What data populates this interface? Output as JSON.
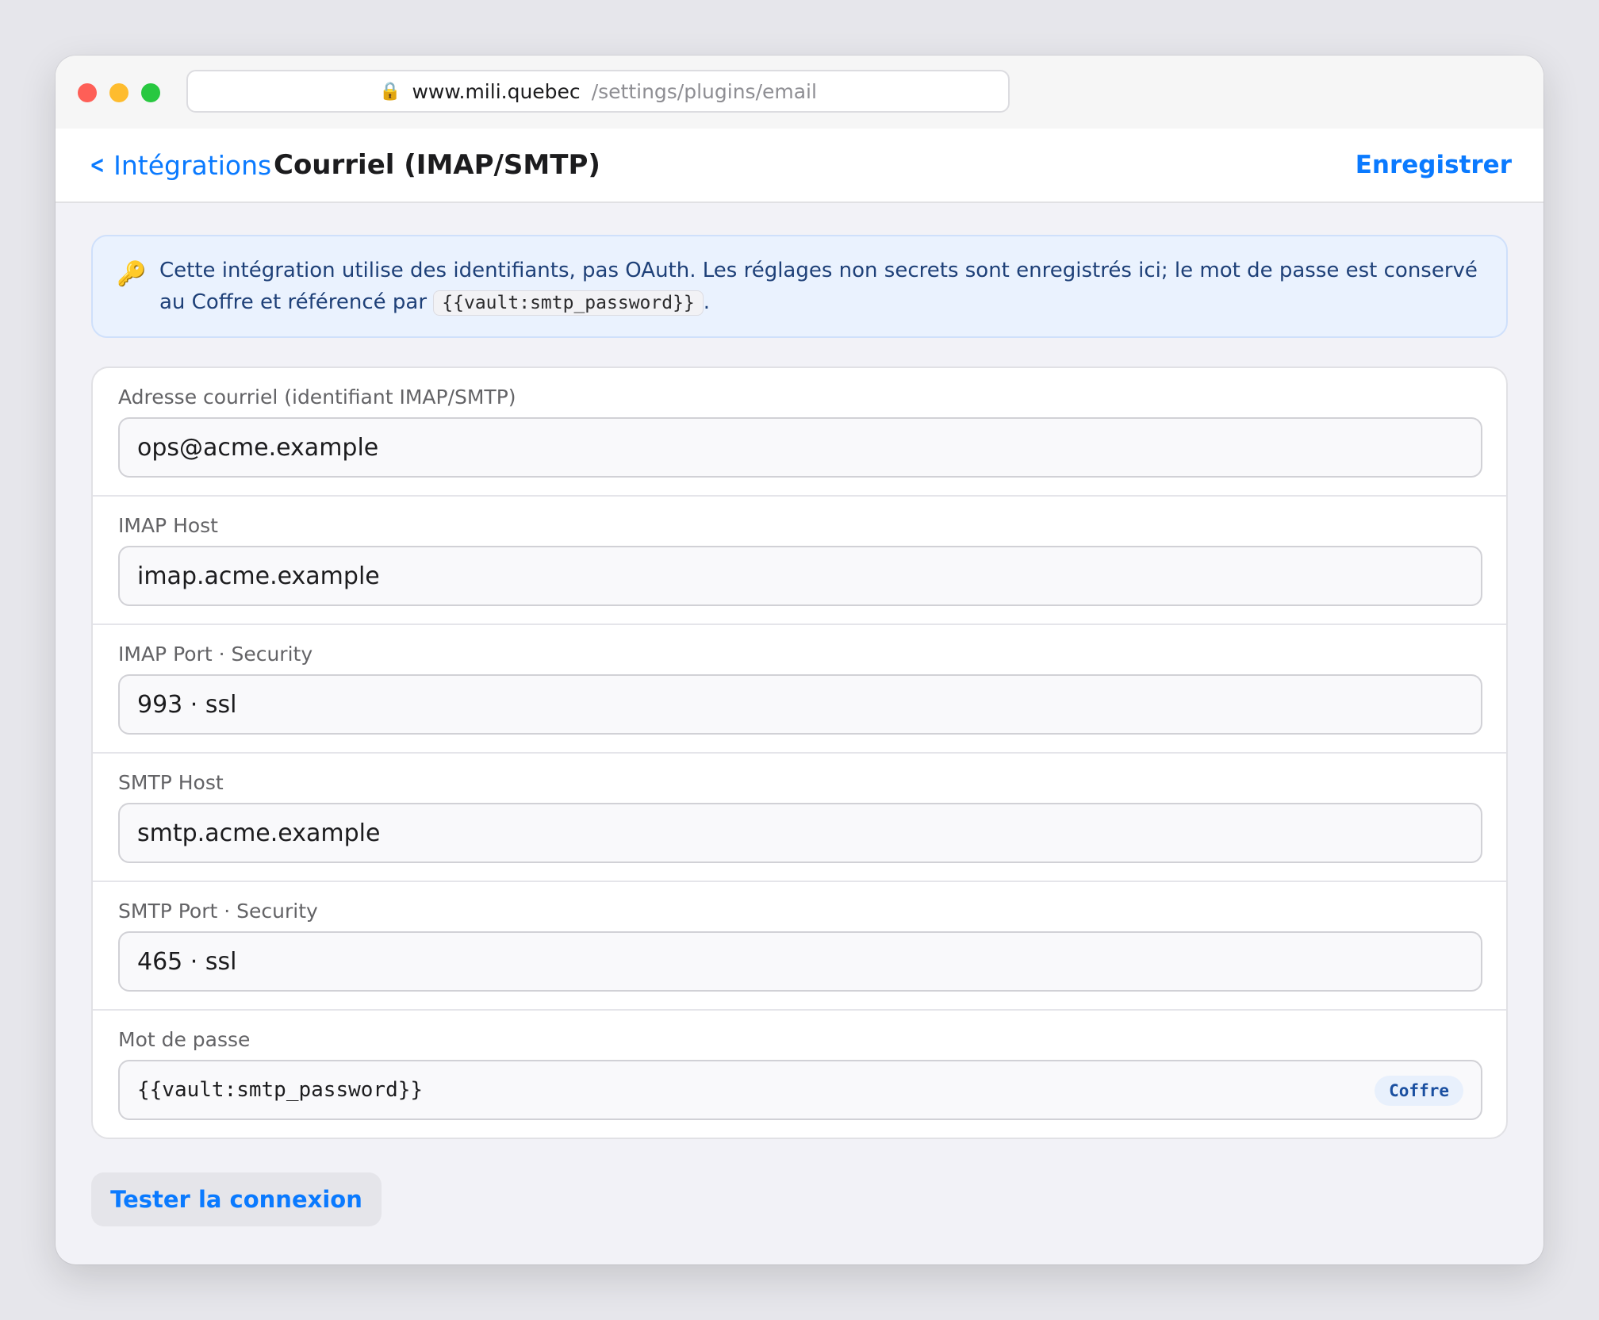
{
  "browser": {
    "domain": "www.mili.quebec",
    "path": "/settings/plugins/email",
    "lock_icon": "lock-icon"
  },
  "nav": {
    "back_label": "Intégrations",
    "title": "Courriel (IMAP/SMTP)",
    "save_label": "Enregistrer"
  },
  "notice": {
    "icon": "key-icon",
    "text": "Cette intégration utilise des identifiants, pas OAuth. Les réglages non secrets sont enregistrés ici; le mot de passe est conservé au Coffre et référencé par",
    "code": "{{vault:smtp_password}}",
    "suffix": "."
  },
  "fields": [
    {
      "label": "Adresse courriel (identifiant IMAP/SMTP)",
      "value": "ops@acme.example"
    },
    {
      "label": "IMAP Host",
      "value": "imap.acme.example"
    },
    {
      "label": "IMAP Port · Security",
      "value": "993 · ssl"
    },
    {
      "label": "SMTP Host",
      "value": "smtp.acme.example"
    },
    {
      "label": "SMTP Port · Security",
      "value": "465 · ssl"
    },
    {
      "label": "Mot de passe",
      "value": "{{vault:smtp_password}}",
      "badge": "Coffre"
    }
  ],
  "actions": {
    "test_label": "Tester la connexion"
  },
  "colors": {
    "accent": "#0a7aff",
    "notice_bg": "#eaf2fe",
    "notice_text": "#1e4078"
  }
}
